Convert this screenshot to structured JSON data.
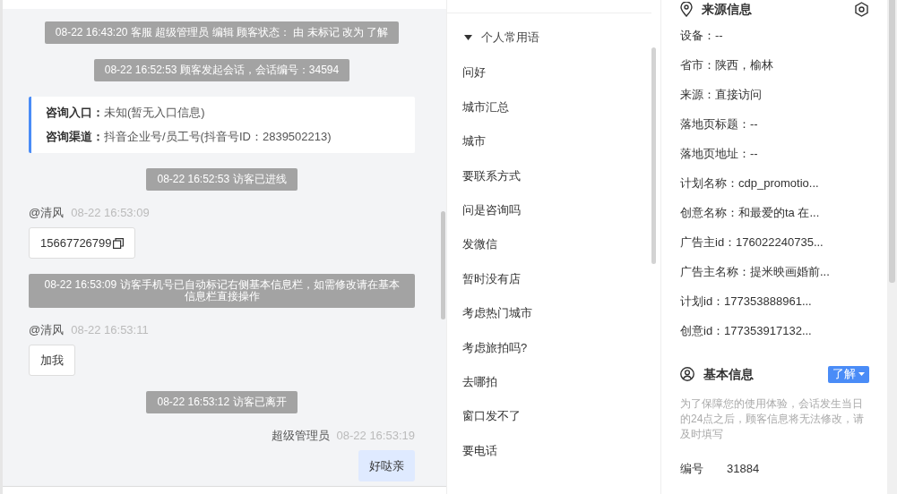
{
  "chat": {
    "messages": [
      {
        "kind": "system",
        "text": "08-22 16:43:20 客服 超级管理员 编辑 顾客状态： 由 未标记 改为 了解"
      },
      {
        "kind": "system",
        "text": "08-22 16:52:53 顾客发起会话，会话编号：34594"
      },
      {
        "kind": "info_card",
        "lines": [
          {
            "label": "咨询入口：",
            "value": "未知(暂无入口信息)"
          },
          {
            "label": "咨询渠道：",
            "value": "抖音企业号/员工号(抖音号ID：2839502213)"
          }
        ]
      },
      {
        "kind": "system",
        "text": "08-22 16:52:53 访客已进线"
      },
      {
        "kind": "visitor",
        "name": "@清风",
        "time": "08-22 16:53:09",
        "text": "15667726799",
        "copyable": true
      },
      {
        "kind": "system",
        "text": "08-22 16:53:09 访客手机号已自动标记右侧基本信息栏，如需修改请在基本信息栏直接操作"
      },
      {
        "kind": "visitor",
        "name": "@清风",
        "time": "08-22 16:53:11",
        "text": "加我",
        "copyable": false
      },
      {
        "kind": "system",
        "text": "08-22 16:53:12 访客已离开"
      },
      {
        "kind": "agent",
        "name": "超级管理员",
        "time": "08-22 16:53:19",
        "text": "好哒亲"
      }
    ]
  },
  "phrases": {
    "group": "个人常用语",
    "expanded": true,
    "items": [
      "问好",
      "城市汇总",
      "城市",
      "要联系方式",
      "问是咨询吗",
      "发微信",
      "暂时没有店",
      "考虑热门城市",
      "考虑旅拍吗?",
      "去哪拍",
      "窗口发不了",
      "要电话"
    ]
  },
  "source_info": {
    "title": "来源信息",
    "fields": [
      "设备：--",
      "省市：陕西，榆林",
      "来源：直接访问",
      "落地页标题：--",
      "落地页地址：--",
      "计划名称：cdp_promotio...",
      "创意名称：和最爱的ta 在...",
      "广告主id：176022240735...",
      "广告主名称：提米映画婚前...",
      "计划id：177353888961...",
      "创意id：177353917132..."
    ]
  },
  "basic_info": {
    "title": "基本信息",
    "status": "了解",
    "notice": "为了保障您的使用体验，会话发生当日的24点之后，顾客信息将无法修改，请及时填写",
    "fields": [
      {
        "label": "编号",
        "value": "31884"
      }
    ]
  }
}
